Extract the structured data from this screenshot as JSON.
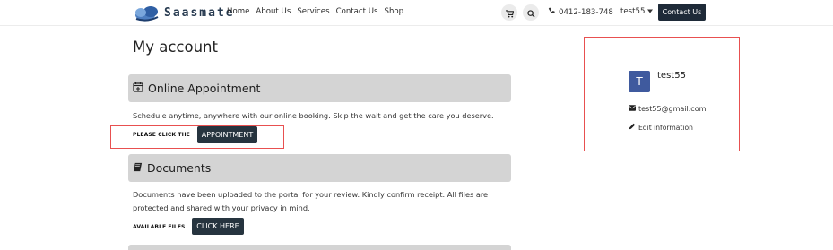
{
  "header": {
    "logo_text": "Saasmate",
    "nav": [
      "Home",
      "About Us",
      "Services",
      "Contact Us",
      "Shop"
    ],
    "phone": "0412-183-748",
    "user": "test55",
    "contact_button": "Contact Us"
  },
  "main": {
    "title": "My account",
    "appointment": {
      "heading": "Online Appointment",
      "description": "Schedule anytime, anywhere with our online booking. Skip the wait and get the care you deserve.",
      "label": "PLEASE CLICK THE",
      "button": "APPOINTMENT"
    },
    "documents": {
      "heading": "Documents",
      "description": "Documents have been uploaded to the portal for your review. Kindly confirm receipt. All files are protected and shared with your privacy in mind.",
      "label": "AVAILABLE FILES",
      "button": "CLICK HERE"
    }
  },
  "profile": {
    "initial": "T",
    "name": "test55",
    "email": "test55@gmail.com",
    "edit_label": "Edit information"
  },
  "colors": {
    "dark_button": "#26343f",
    "section_bg": "#d4d4d4",
    "highlight_border": "#e85050",
    "avatar_bg": "#3f5a9e"
  }
}
